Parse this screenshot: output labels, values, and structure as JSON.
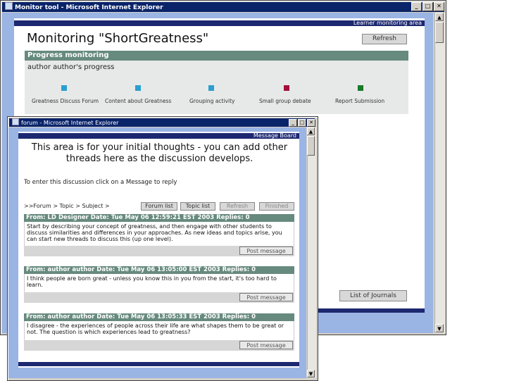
{
  "main_window": {
    "title": "Monitor tool - Microsoft Internet Explorer",
    "header_label": "Learner monitoring area",
    "page_title": "Monitoring \"ShortGreatness\"",
    "refresh_label": "Refresh",
    "section_title": "Progress monitoring",
    "subtitle": "author author's progress",
    "activities": [
      {
        "label": "Greatness Discuss Forum",
        "color": "#2a9fd0"
      },
      {
        "label": "Content about Greatness",
        "color": "#2a9fd0"
      },
      {
        "label": "Grouping activity",
        "color": "#2a9fd0"
      },
      {
        "label": "Small group debate",
        "color": "#a0103a"
      },
      {
        "label": "Report Submission",
        "color": "#177a2a"
      }
    ],
    "journals_label": "List of Journals"
  },
  "forum_window": {
    "title": "forum - Microsoft Internet Explorer",
    "header_label": "Message Board",
    "heading": "This area is for your initial thoughts - you can add other threads here as the discussion develops.",
    "instruction": "To enter this discussion click on a Message to reply",
    "breadcrumb": ">>Forum > Topic > Subject >",
    "nav_buttons": [
      "Forum list",
      "Topic list",
      "Refresh",
      "Finished"
    ],
    "messages": [
      {
        "header": "From: LD Designer   Date: Tue May 06 12:59:21 EST 2003   Replies: 0",
        "body": "Start by describing your concept of greatness, and then engage with other students to discuss similarities and differences in your approaches. As new ideas and topics arise, you can start new threads to discuss this (up one level).",
        "post_label": "Post message"
      },
      {
        "header": "From: author author   Date: Tue May 06 13:05:00 EST 2003   Replies: 0",
        "body": "I think people are born great - unless you know this in you from the start, it's too hard to learn.",
        "post_label": "Post message"
      },
      {
        "header": "From: author author   Date: Tue May 06 13:05:33 EST 2003   Replies: 0",
        "body": "I disagree - the experiences of people across their life are what shapes them to be great or not. The question is which experiences lead to greatness?",
        "post_label": "Post message"
      }
    ]
  }
}
